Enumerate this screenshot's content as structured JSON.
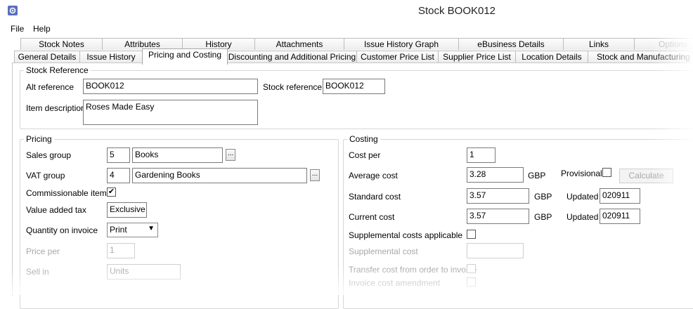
{
  "window": {
    "title": "Stock BOOK012",
    "icon": "gear-app-icon"
  },
  "menu": [
    "File",
    "Help"
  ],
  "tabs_row1": [
    "Stock Notes",
    "Attributes",
    "History",
    "Attachments",
    "Issue History Graph",
    "eBusiness Details",
    "Links",
    "Options"
  ],
  "tabs_row2": [
    "General Details",
    "Issue History",
    "Pricing and Costing",
    "Discounting and Additional Pricing",
    "Customer Price List",
    "Supplier Price List",
    "Location Details",
    "Stock and Manufacturing"
  ],
  "active_tab": "Pricing and Costing",
  "stock_reference": {
    "title": "Stock Reference",
    "alt_reference_label": "Alt reference",
    "alt_reference_value": "BOOK012",
    "stock_reference_label": "Stock reference",
    "stock_reference_value": "BOOK012",
    "item_description_label": "Item description",
    "item_description_value": "Roses Made Easy"
  },
  "pricing": {
    "title": "Pricing",
    "sales_group_label": "Sales group",
    "sales_group_code": "5",
    "sales_group_name": "Books",
    "vat_group_label": "VAT group",
    "vat_group_code": "4",
    "vat_group_name": "Gardening Books",
    "commissionable_label": "Commissionable item",
    "commissionable_checked": "✔",
    "value_added_tax_label": "Value added tax",
    "value_added_tax_value": "Exclusive",
    "quantity_on_invoice_label": "Quantity on invoice",
    "quantity_on_invoice_value": "Print",
    "price_per_label": "Price per",
    "price_per_value": "1",
    "sell_in_label": "Sell in",
    "sell_in_value": "Units",
    "ellipsis": "..."
  },
  "costing": {
    "title": "Costing",
    "cost_per_label": "Cost per",
    "cost_per_value": "1",
    "average_cost_label": "Average cost",
    "average_cost_value": "3.28",
    "currency": "GBP",
    "provisional_label": "Provisional",
    "calculate_label": "Calculate",
    "standard_cost_label": "Standard cost",
    "standard_cost_value": "3.57",
    "updated_label": "Updated",
    "standard_updated_value": "020911",
    "current_cost_label": "Current cost",
    "current_cost_value": "3.57",
    "current_updated_value": "020911",
    "supplemental_applicable_label": "Supplemental costs applicable",
    "supplemental_cost_label": "Supplemental cost",
    "transfer_cost_label": "Transfer cost from order to invoice",
    "invoice_cost_amendment_label": "Invoice cost amendment"
  }
}
